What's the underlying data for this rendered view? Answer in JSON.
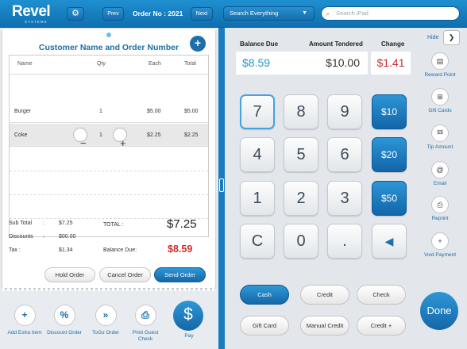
{
  "topbar": {
    "logo": "Revel",
    "logo_sub": "SYSTEMS",
    "settings_icon": "gear-icon",
    "prev_label": "Prev",
    "order_no": "Order No : 2021",
    "next_label": "Next",
    "search_dropdown_label": "Search Everything",
    "search_placeholder": "Search iPad"
  },
  "order": {
    "customer_title": "Customer Name and Order Number",
    "columns": {
      "name": "Name",
      "qty": "Qty",
      "each": "Each",
      "total": "Total"
    },
    "items": [
      {
        "name": "Burger",
        "qty": "1",
        "each": "$5.00",
        "total": "$5.00"
      },
      {
        "name": "Coke",
        "qty": "1",
        "each": "$2.25",
        "total": "$2.25"
      }
    ],
    "subtotal_label": "Sub Total",
    "subtotal": "$7.25",
    "discounts_label": "Discounts",
    "discounts": "$00.00",
    "tax_label": "Tax :",
    "tax": "$1.34",
    "total_label": "TOTAL :",
    "total": "$7.25",
    "balance_due_label": "Balance Due:",
    "balance_due": "$8.59",
    "colon": ":"
  },
  "actions": {
    "hold": "Hold Order",
    "cancel": "Cancel Order",
    "send": "Send Order"
  },
  "tools": [
    {
      "label": "Add Extra Item",
      "icon": "plus-icon",
      "glyph": "+"
    },
    {
      "label": "Discount Order",
      "icon": "percent-icon",
      "glyph": "%"
    },
    {
      "label": "ToGo Order",
      "icon": "fast-forward-icon",
      "glyph": "»"
    },
    {
      "label": "Print Guest Check",
      "icon": "printer-icon",
      "glyph": "⎙"
    }
  ],
  "pay": {
    "label": "Pay",
    "glyph": "$"
  },
  "payment": {
    "balance_due_label": "Balance Due",
    "balance_due": "$8.59",
    "tendered_label": "Amount Tendered",
    "tendered": "$10.00",
    "change_label": "Change",
    "change": "$1.41"
  },
  "keypad": {
    "k7": "7",
    "k8": "8",
    "k9": "9",
    "q10": "$10",
    "k4": "4",
    "k5": "5",
    "k6": "6",
    "q20": "$20",
    "k1": "1",
    "k2": "2",
    "k3": "3",
    "q50": "$50",
    "clear": "C",
    "k0": "0",
    "dot": ".",
    "back": "◀"
  },
  "methods": {
    "cash": "Cash",
    "credit": "Credit",
    "check": "Check",
    "gift_card": "Gift Card",
    "manual_credit": "Manual Credit",
    "credit_plus": "Credit +"
  },
  "done_label": "Done",
  "side": {
    "hide_label": "Hide",
    "items": [
      {
        "label": "Reward Point",
        "icon": "reward-card-icon",
        "glyph": "▤"
      },
      {
        "label": "Gift Cards",
        "icon": "gift-icon",
        "glyph": "⊞"
      },
      {
        "label": "Tip Amount",
        "icon": "tip-coins-icon",
        "glyph": "$$"
      },
      {
        "label": "Email",
        "icon": "email-at-icon",
        "glyph": "@"
      },
      {
        "label": "Reprint",
        "icon": "printer-icon",
        "glyph": "⎙"
      },
      {
        "label": "Void Payment",
        "icon": "plus-icon",
        "glyph": "+"
      }
    ]
  },
  "colors": {
    "brand_blue": "#1c6fab",
    "balance_due": "#2196d3",
    "change_red": "#c8302f"
  }
}
